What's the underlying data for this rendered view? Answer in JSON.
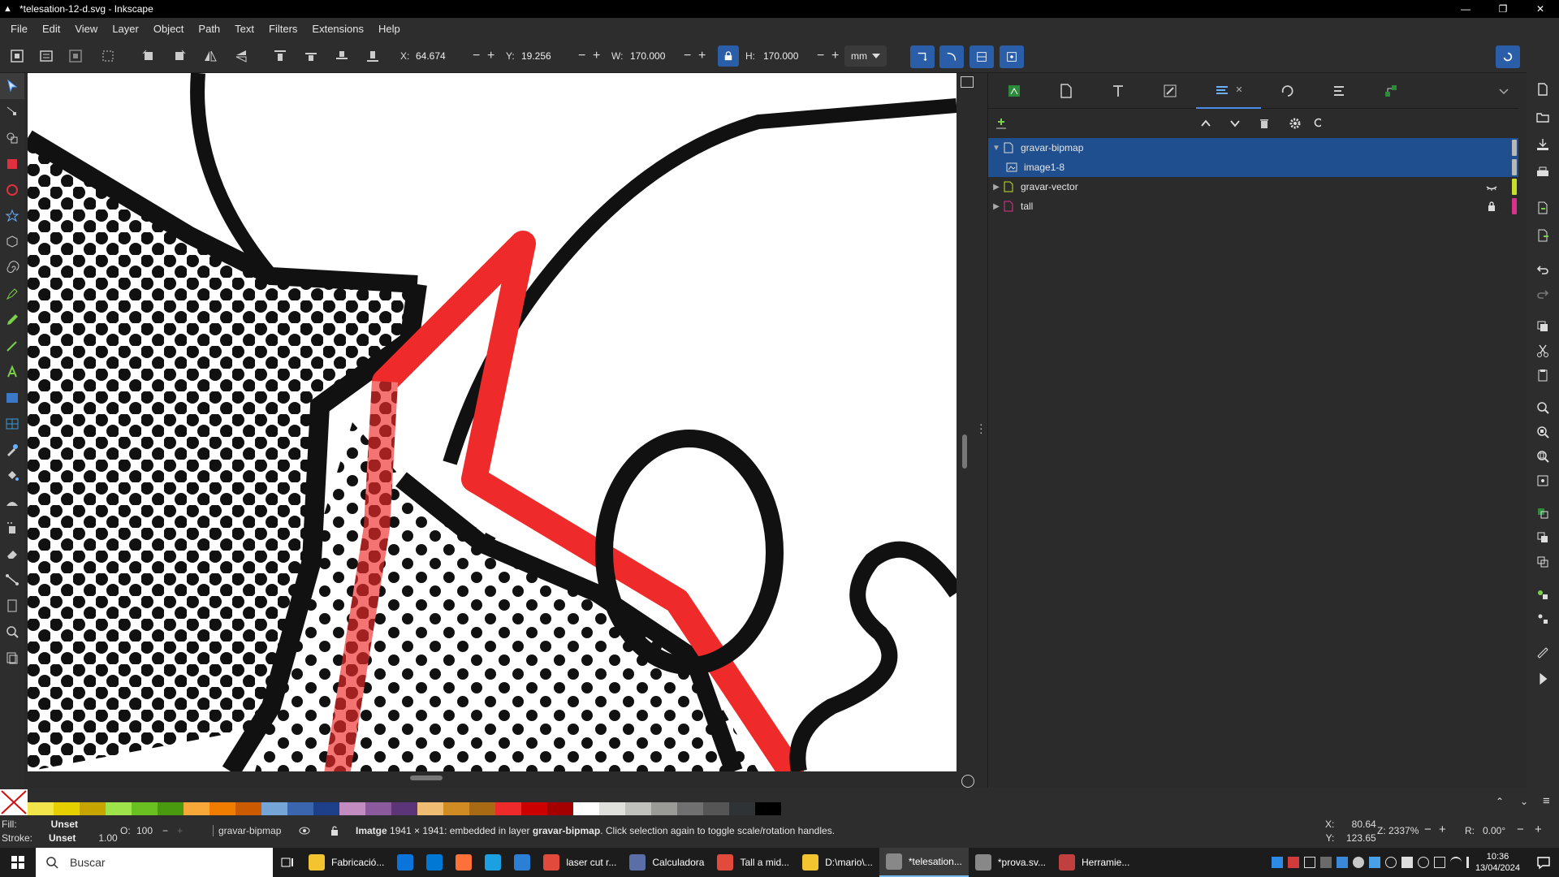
{
  "window": {
    "title": "*telesation-12-d.svg - Inkscape",
    "minimize": "—",
    "maximize": "❐",
    "close": "✕"
  },
  "menu": [
    "File",
    "Edit",
    "View",
    "Layer",
    "Object",
    "Path",
    "Text",
    "Filters",
    "Extensions",
    "Help"
  ],
  "toolctrl": {
    "x_label": "X:",
    "x_value": "64.674",
    "y_label": "Y:",
    "y_value": "19.256",
    "w_label": "W:",
    "w_value": "170.000",
    "h_label": "H:",
    "h_value": "170.000",
    "unit": "mm",
    "minus": "−",
    "plus": "+"
  },
  "layers": {
    "rows": [
      {
        "name": "gravar-bipmap",
        "color": "#b8b8b8"
      },
      {
        "name": "image1-8",
        "color": "#b8b8b8"
      },
      {
        "name": "gravar-vector",
        "color": "#c6e02a"
      },
      {
        "name": "tall",
        "color": "#d8338c"
      }
    ]
  },
  "palette": {
    "colors": [
      "#f2e54b",
      "#e6cf00",
      "#c8a400",
      "#9ee34a",
      "#6ac020",
      "#4a9a10",
      "#f8a838",
      "#f07c00",
      "#cc5a00",
      "#77a4d6",
      "#3a66b0",
      "#1e3f8a",
      "#c28cc0",
      "#8a5a9c",
      "#5c3478",
      "#eebc72",
      "#d08c22",
      "#a86a12",
      "#ee2a2a",
      "#cc0000",
      "#a40000",
      "#ffffff",
      "#e0e0dc",
      "#c0c0bc",
      "#9a9a96",
      "#707070",
      "#555555",
      "#2e3436",
      "#000000"
    ],
    "up": "⌃",
    "down": "⌄",
    "menu": "≡"
  },
  "status": {
    "fill_label": "Fill:",
    "fill_value": "Unset",
    "stroke_label": "Stroke:",
    "stroke_value": "Unset",
    "stroke_width": "1.00",
    "opacity_label": "O:",
    "opacity_value": "100",
    "layer_name": "gravar-bipmap",
    "message_prefix": "Imatge",
    "message_mid": " 1941 × 1941: embedded in layer ",
    "message_layer": "gravar-bipmap",
    "message_suffix": ". Click selection again to toggle scale/rotation handles.",
    "x_label": "X:",
    "x_value": "80.64",
    "y_label": "Y:",
    "y_value": "123.65",
    "zoom_label": "Z:",
    "zoom_value": "2337%",
    "rot_label": "R:",
    "rot_value": "0.00°"
  },
  "taskbar": {
    "search_placeholder": "Buscar",
    "apps": [
      {
        "label": "Fabricació...",
        "color": "#f4c430",
        "active": false
      },
      {
        "label": "",
        "color": "#0a74da",
        "active": false
      },
      {
        "label": "",
        "color": "#0078d4",
        "active": false
      },
      {
        "label": "",
        "color": "#ff7139",
        "active": false
      },
      {
        "label": "",
        "color": "#1ba0e2",
        "active": false
      },
      {
        "label": "",
        "color": "#2b7fd4",
        "active": false
      },
      {
        "label": "laser cut r...",
        "color": "#e24a3b",
        "active": false
      },
      {
        "label": "Calculadora",
        "color": "#5a6ea8",
        "active": false
      },
      {
        "label": "Tall a mid...",
        "color": "#e24a3b",
        "active": false
      },
      {
        "label": "D:\\mario\\...",
        "color": "#f4c430",
        "active": false
      },
      {
        "label": "*telesation...",
        "color": "#888888",
        "active": true
      },
      {
        "label": "*prova.sv...",
        "color": "#888888",
        "active": false
      },
      {
        "label": "Herramie...",
        "color": "#c04040",
        "active": false
      }
    ],
    "time": "10:36",
    "date": "13/04/2024"
  }
}
